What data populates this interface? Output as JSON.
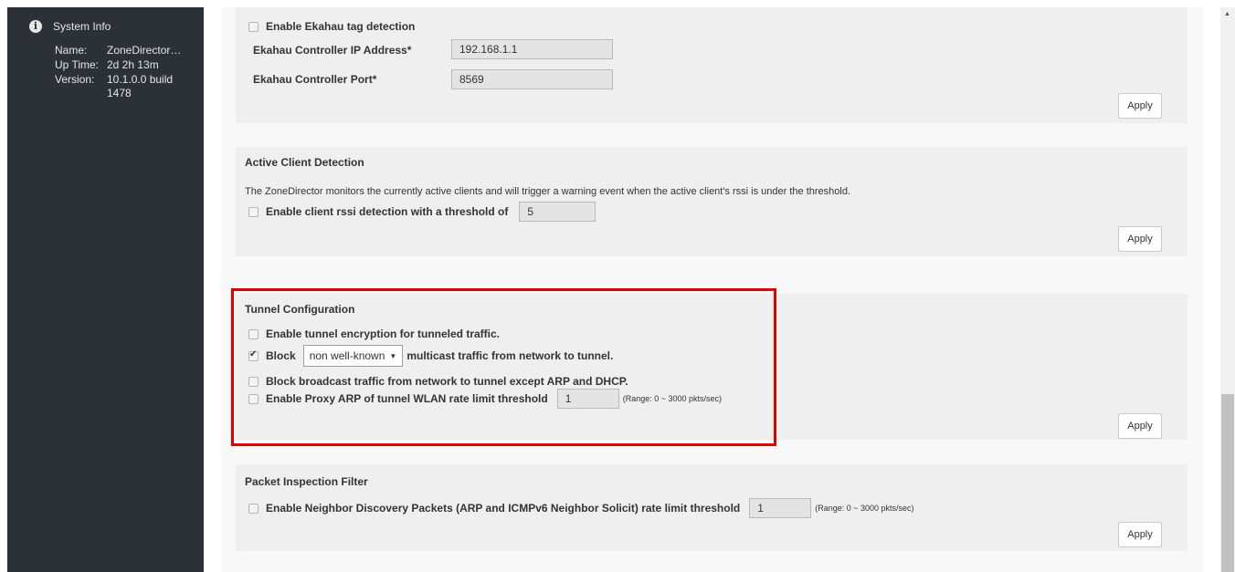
{
  "sidebar": {
    "title": "System Info",
    "info": [
      {
        "key": "Name:",
        "value": "ZoneDirector…"
      },
      {
        "key": "Up Time:",
        "value": "2d 2h 13m"
      },
      {
        "key": "Version:",
        "value": "10.1.0.0 build 1478"
      }
    ]
  },
  "ekahau": {
    "enable_label": "Enable Ekahau tag detection",
    "enabled": false,
    "ip_label": "Ekahau Controller IP Address*",
    "ip_value": "192.168.1.1",
    "port_label": "Ekahau Controller Port*",
    "port_value": "8569",
    "apply": "Apply"
  },
  "active_client": {
    "title": "Active Client Detection",
    "description": "The ZoneDirector monitors the currently active clients and will trigger a warning event when the active client's rssi is under the threshold.",
    "enable_label": "Enable client rssi detection with a threshold of",
    "enabled": false,
    "threshold": "5",
    "apply": "Apply"
  },
  "tunnel": {
    "title": "Tunnel Configuration",
    "encryption_label": "Enable tunnel encryption for tunneled traffic.",
    "encryption": false,
    "block_label": "Block",
    "block": true,
    "block_select": "non well-known",
    "block_suffix": "multicast traffic from network to tunnel.",
    "broadcast_label": "Block broadcast traffic from network to tunnel except ARP and DHCP.",
    "broadcast": false,
    "proxy_label": "Enable Proxy ARP of tunnel WLAN rate limit threshold",
    "proxy": false,
    "proxy_value": "1",
    "proxy_range": "(Range: 0 ~ 3000 pkts/sec)",
    "apply": "Apply"
  },
  "packet": {
    "title": "Packet Inspection Filter",
    "nd_label": "Enable Neighbor Discovery Packets (ARP and ICMPv6 Neighbor Solicit) rate limit threshold",
    "nd": false,
    "nd_value": "1",
    "nd_range": "(Range: 0 ~ 3000 pkts/sec)",
    "apply": "Apply"
  },
  "colors": {
    "sidebar_bg": "#2b3136",
    "highlight": "#e00000",
    "panel_bg": "#efefef"
  }
}
